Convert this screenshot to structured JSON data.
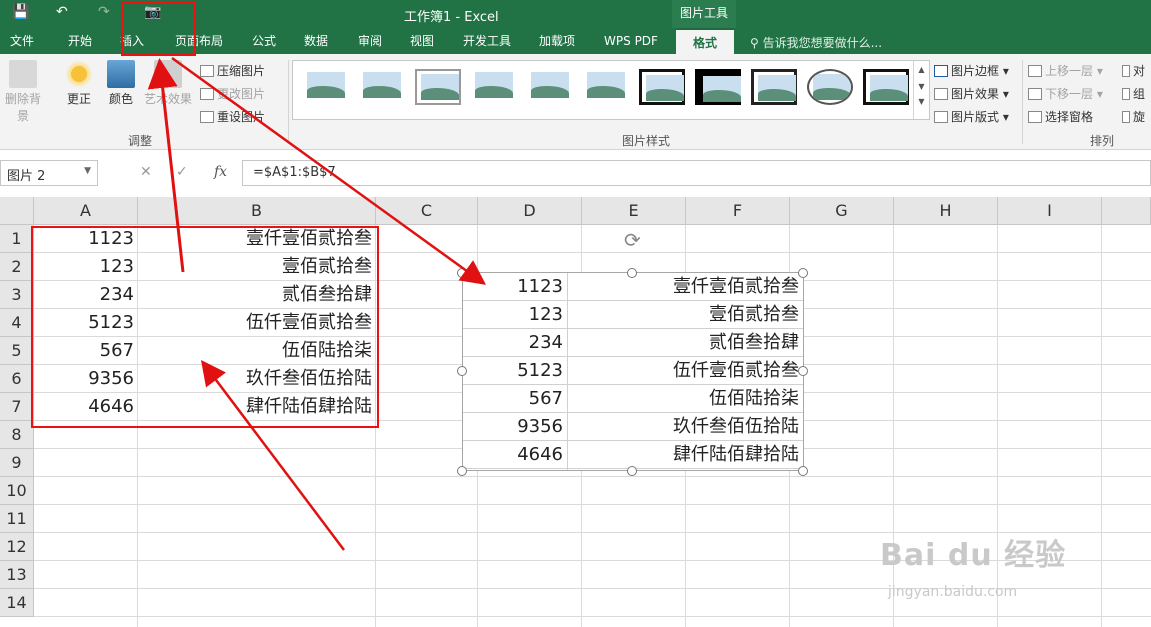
{
  "window": {
    "title": "工作簿1 - Excel",
    "context_tab_group": "图片工具"
  },
  "quick_access": {
    "save_icon": "save-icon",
    "undo_icon": "undo-icon",
    "redo_icon": "redo-icon",
    "camera_icon": "camera-icon"
  },
  "tabs": [
    "文件",
    "开始",
    "插入",
    "页面布局",
    "公式",
    "数据",
    "审阅",
    "视图",
    "开发工具",
    "加载项",
    "WPS PDF",
    "格式"
  ],
  "active_tab": "格式",
  "tell_me": "告诉我您想要做什么...",
  "ribbon": {
    "adjust": {
      "remove_bg": "删除背景",
      "corrections": "更正",
      "color": "颜色",
      "artistic": "艺术效果",
      "compress": "压缩图片",
      "change": "更改图片",
      "reset": "重设图片",
      "label": "调整"
    },
    "styles": {
      "label": "图片样式",
      "border": "图片边框",
      "effects": "图片效果",
      "layout": "图片版式"
    },
    "arrange": {
      "label": "排列",
      "bring_forward": "上移一层",
      "send_backward": "下移一层",
      "selection_pane": "选择窗格",
      "align": "对",
      "group": "组",
      "rotate": "旋"
    }
  },
  "formula_bar": {
    "name_box": "图片 2",
    "cancel": "✕",
    "enter": "✓",
    "fx": "fx",
    "formula": "=$A$1:$B$7"
  },
  "columns": [
    "A",
    "B",
    "C",
    "D",
    "E",
    "F",
    "G",
    "H",
    "I"
  ],
  "rows": [
    "1",
    "2",
    "3",
    "4",
    "5",
    "6",
    "7",
    "8",
    "9",
    "10",
    "11",
    "12",
    "13",
    "14"
  ],
  "cells": [
    {
      "a": "1123",
      "b": "壹仟壹佰贰拾叁"
    },
    {
      "a": "123",
      "b": "壹佰贰拾叁"
    },
    {
      "a": "234",
      "b": "贰佰叁拾肆"
    },
    {
      "a": "5123",
      "b": "伍仟壹佰贰拾叁"
    },
    {
      "a": "567",
      "b": "伍佰陆拾柒"
    },
    {
      "a": "9356",
      "b": "玖仟叁佰伍拾陆"
    },
    {
      "a": "4646",
      "b": "肆仟陆佰肆拾陆"
    }
  ],
  "watermark": {
    "main": "Bai du 经验",
    "sub": "jingyan.baidu.com"
  },
  "accent_color": "#217346",
  "annotation_color": "#e11111"
}
